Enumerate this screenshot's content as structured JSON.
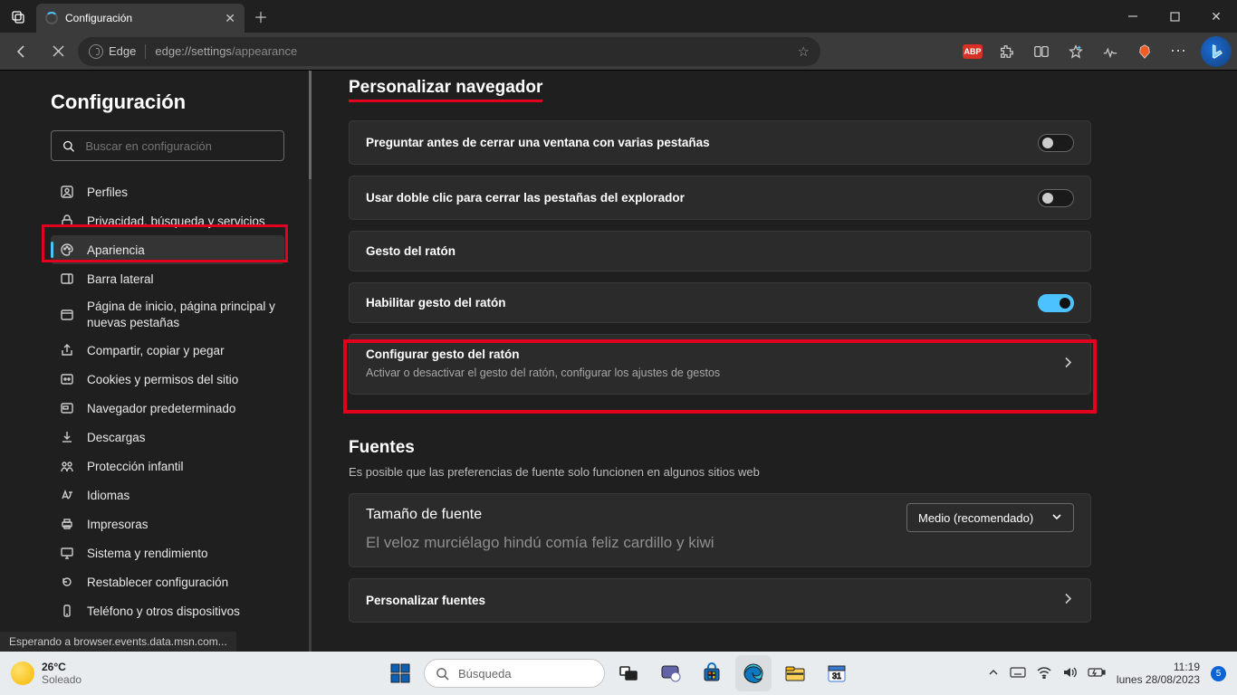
{
  "window": {
    "tab_title": "Configuración"
  },
  "toolbar": {
    "edge_label": "Edge",
    "url_host": "edge://settings",
    "url_path": "/appearance",
    "abp_label": "ABP"
  },
  "sidebar": {
    "title": "Configuración",
    "search_placeholder": "Buscar en configuración",
    "items": [
      {
        "label": "Perfiles"
      },
      {
        "label": "Privacidad, búsqueda y servicios"
      },
      {
        "label": "Apariencia"
      },
      {
        "label": "Barra lateral"
      },
      {
        "label": "Página de inicio, página principal y nuevas pestañas"
      },
      {
        "label": "Compartir, copiar y pegar"
      },
      {
        "label": "Cookies y permisos del sitio"
      },
      {
        "label": "Navegador predeterminado"
      },
      {
        "label": "Descargas"
      },
      {
        "label": "Protección infantil"
      },
      {
        "label": "Idiomas"
      },
      {
        "label": "Impresoras"
      },
      {
        "label": "Sistema y rendimiento"
      },
      {
        "label": "Restablecer configuración"
      },
      {
        "label": "Teléfono y otros dispositivos"
      }
    ]
  },
  "main": {
    "section1_title": "Personalizar navegador",
    "ask_close_label": "Preguntar antes de cerrar una ventana con varias pestañas",
    "dblclick_label": "Usar doble clic para cerrar las pestañas del explorador",
    "mouse_header": "Gesto del ratón",
    "mouse_enable": "Habilitar gesto del ratón",
    "mouse_cfg_title": "Configurar gesto del ratón",
    "mouse_cfg_sub": "Activar o desactivar el gesto del ratón, configurar los ajustes de gestos",
    "fonts_title": "Fuentes",
    "fonts_note": "Es posible que las preferencias de fuente solo funcionen en algunos sitios web",
    "font_size_label": "Tamaño de fuente",
    "font_size_value": "Medio (recomendado)",
    "font_sample": "El veloz murciélago hindú comía feliz cardillo y kiwi",
    "customize_fonts": "Personalizar fuentes"
  },
  "status_text": "Esperando a browser.events.data.msn.com...",
  "taskbar": {
    "temp": "26°C",
    "temp_desc": "Soleado",
    "search_placeholder": "Búsqueda",
    "time": "11:19",
    "date": "lunes 28/08/2023",
    "notif_count": "5",
    "cal_day": "31"
  }
}
